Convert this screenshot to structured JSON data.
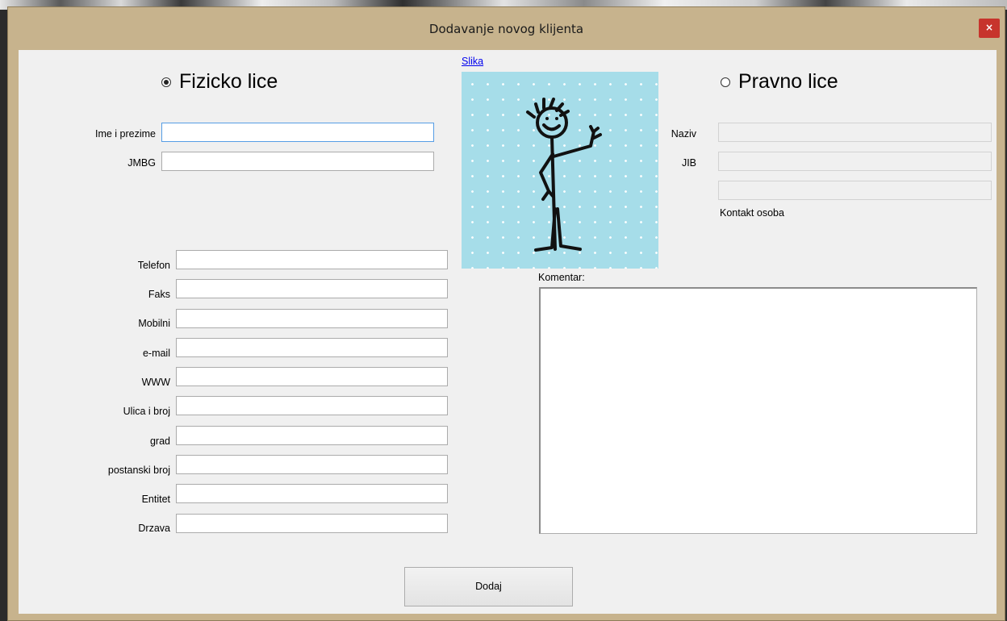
{
  "window": {
    "title": "Dodavanje novog klijenta",
    "close_glyph": "×"
  },
  "individual": {
    "radio_label": "Fizicko lice",
    "selected": true,
    "fields": [
      {
        "label": "Ime i prezime",
        "value": ""
      },
      {
        "label": "JMBG",
        "value": ""
      }
    ]
  },
  "contact": {
    "fields": [
      {
        "label": "Telefon",
        "value": ""
      },
      {
        "label": "Faks",
        "value": ""
      },
      {
        "label": "Mobilni",
        "value": ""
      },
      {
        "label": "e-mail",
        "value": ""
      },
      {
        "label": "WWW",
        "value": ""
      },
      {
        "label": "Ulica i broj",
        "value": ""
      },
      {
        "label": "grad",
        "value": ""
      },
      {
        "label": "postanski broj",
        "value": ""
      },
      {
        "label": "Entitet",
        "value": ""
      },
      {
        "label": "Drzava",
        "value": ""
      }
    ]
  },
  "picture": {
    "link_label": "Slika"
  },
  "legal": {
    "radio_label": "Pravno lice",
    "selected": false,
    "naziv_label": "Naziv",
    "jib_label": "JIB",
    "contact_person_label": "Kontakt osoba"
  },
  "comment": {
    "label": "Komentar:",
    "value": ""
  },
  "submit_label": "Dodaj"
}
